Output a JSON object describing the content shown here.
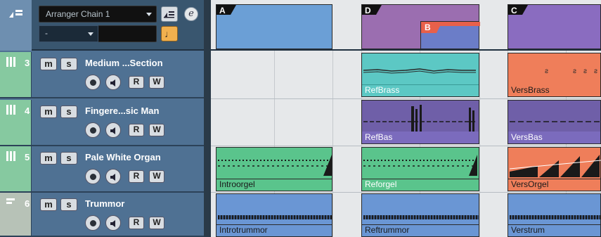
{
  "arranger": {
    "chain_name": "Arranger Chain 1",
    "sub_value": "-",
    "note_icon": "♩",
    "e_icon": "e",
    "events": [
      {
        "letter": "A",
        "color": "#6b9fd6"
      },
      {
        "letter": "D",
        "color": "#9b6eb0"
      },
      {
        "letter": "B",
        "color": "#e8604a"
      },
      {
        "letter": "C",
        "color": "#8a6cc0"
      }
    ]
  },
  "tracks": [
    {
      "number": "3",
      "name": "Medium ...Section",
      "color": "#86c9a0",
      "icon": "instrument-track-icon"
    },
    {
      "number": "4",
      "name": "Fingere...sic Man",
      "color": "#86c9a0",
      "icon": "instrument-track-icon"
    },
    {
      "number": "5",
      "name": "Pale White Organ",
      "color": "#86c9a0",
      "icon": "instrument-track-icon"
    },
    {
      "number": "6",
      "name": "Trummor",
      "color": "#b7c2b7",
      "icon": "drum-track-icon"
    }
  ],
  "buttons": {
    "mute": "m",
    "solo": "s",
    "read": "R",
    "write": "W"
  },
  "events": {
    "refbrass": "RefBrass",
    "versbrass": "VersBrass",
    "refbas": "RefBas",
    "versbas": "VersBas",
    "introorgel": "Introorgel",
    "reforgel": "Reforgel",
    "versorgel": "VersOrgel",
    "introtrummor": "Introtrummor",
    "reftrummor": "Reftrummor",
    "verstrum": "Verstrum"
  },
  "colors": {
    "cyan": "#5cc8c4",
    "orange": "#ef7e5a",
    "purple": "#6f5fa8",
    "green": "#5ac48c",
    "blue": "#6a96d4"
  }
}
